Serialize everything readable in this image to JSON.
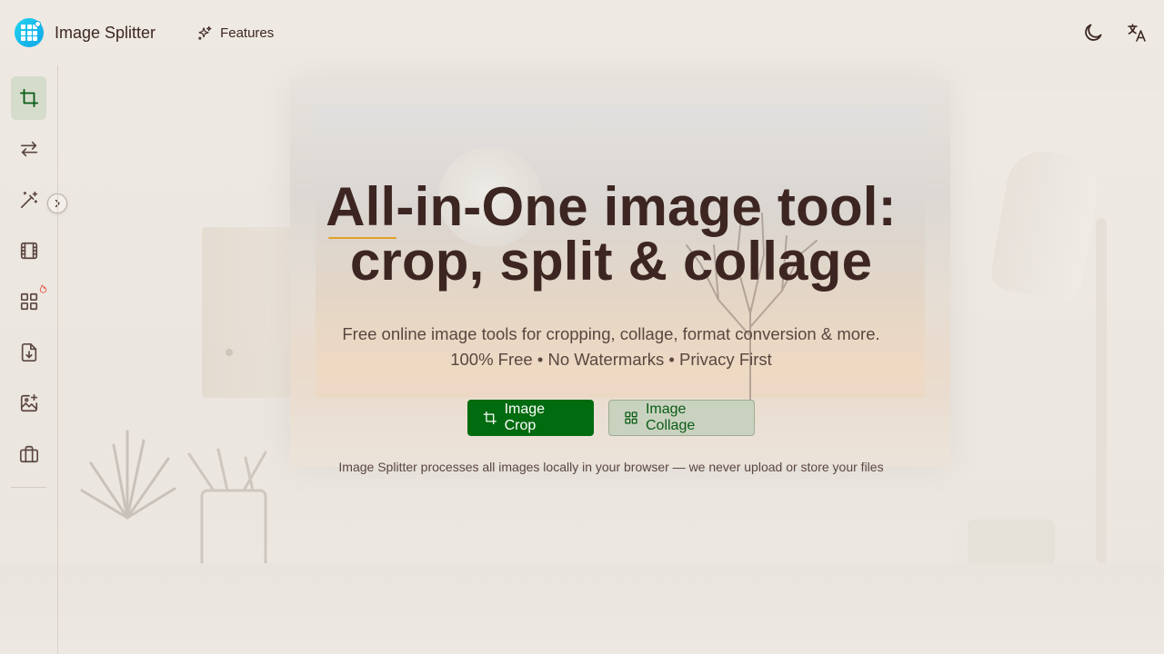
{
  "header": {
    "brand": "Image Splitter",
    "nav": [
      {
        "label": "Features",
        "icon": "sparkles-icon"
      }
    ],
    "actions": [
      {
        "name": "theme-toggle",
        "icon": "moon-icon"
      },
      {
        "name": "language-switcher",
        "icon": "translate-icon"
      }
    ]
  },
  "sidebar": {
    "items": [
      {
        "id": "crop",
        "icon": "crop-icon",
        "active": true
      },
      {
        "id": "convert",
        "icon": "swap-arrows-icon"
      },
      {
        "id": "enhance",
        "icon": "magic-wand-icon"
      },
      {
        "id": "video",
        "icon": "film-icon"
      },
      {
        "id": "collage",
        "icon": "grid-icon",
        "badge": "fire-icon"
      },
      {
        "id": "download",
        "icon": "file-download-icon"
      },
      {
        "id": "image-add",
        "icon": "image-plus-icon"
      },
      {
        "id": "toolbox",
        "icon": "briefcase-icon"
      }
    ],
    "expand_icon": "chevron-right-icon"
  },
  "hero": {
    "title_line1": "All-in-One image tool:",
    "title_line2": "crop, split & collage",
    "subtitle_line1": "Free online image tools for cropping, collage, format conversion & more.",
    "subtitle_line2": "100% Free • No Watermarks • Privacy First",
    "primary_button": "Image Crop",
    "secondary_button": "Image Collage",
    "privacy_note": "Image Splitter processes all images locally in your browser — we never upload or store your files"
  },
  "colors": {
    "background": "#ede8e2",
    "text": "#3d2622",
    "primary": "#006b0f",
    "secondary_bg": "#c9d2bf",
    "accent_underline": "#e0a126",
    "active_item_bg": "#d6dccb"
  }
}
